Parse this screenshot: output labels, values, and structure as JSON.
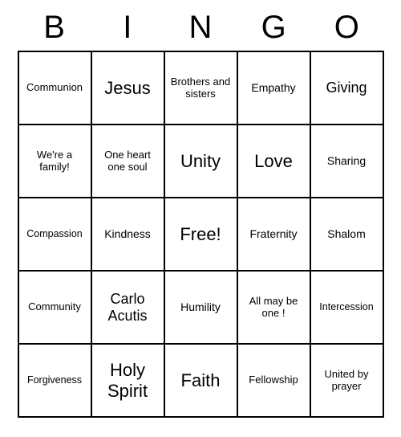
{
  "header": [
    "B",
    "I",
    "N",
    "G",
    "O"
  ],
  "cells": [
    {
      "text": "Communion",
      "size": "small"
    },
    {
      "text": "Jesus",
      "size": "large"
    },
    {
      "text": "Brothers and sisters",
      "size": "small"
    },
    {
      "text": "Empathy",
      "size": ""
    },
    {
      "text": "Giving",
      "size": "med"
    },
    {
      "text": "We're a family!",
      "size": "small"
    },
    {
      "text": "One heart one soul",
      "size": "small"
    },
    {
      "text": "Unity",
      "size": "large"
    },
    {
      "text": "Love",
      "size": "large"
    },
    {
      "text": "Sharing",
      "size": ""
    },
    {
      "text": "Compassion",
      "size": "xsmall"
    },
    {
      "text": "Kindness",
      "size": ""
    },
    {
      "text": "Free!",
      "size": "large"
    },
    {
      "text": "Fraternity",
      "size": ""
    },
    {
      "text": "Shalom",
      "size": ""
    },
    {
      "text": "Community",
      "size": "small"
    },
    {
      "text": "Carlo Acutis",
      "size": "med"
    },
    {
      "text": "Humility",
      "size": ""
    },
    {
      "text": "All may be one !",
      "size": "small"
    },
    {
      "text": "Intercession",
      "size": "xsmall"
    },
    {
      "text": "Forgiveness",
      "size": "xsmall"
    },
    {
      "text": "Holy Spirit",
      "size": "large"
    },
    {
      "text": "Faith",
      "size": "large"
    },
    {
      "text": "Fellowship",
      "size": "small"
    },
    {
      "text": "United by prayer",
      "size": "small"
    }
  ]
}
